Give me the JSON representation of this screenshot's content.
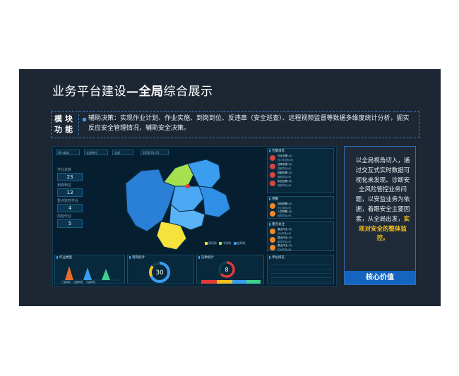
{
  "slide": {
    "title_prefix": "业务平台建设",
    "title_bold": "—全局",
    "title_suffix": "综合展示"
  },
  "module": {
    "label": "模块功能",
    "text": "辅助决策：实现作业计划、作业实施、到岗到位、反违章（安全巡查）、远程视频监督等数据多维度统计分析，掘实反应安全管理情况，辅助安全决策。"
  },
  "dashboard": {
    "selects": [
      "四川省电",
      "全部单位",
      "全部",
      "2020-01-01"
    ],
    "stats": [
      {
        "label": "作业总数",
        "value": "23"
      },
      {
        "label": "到岗到位",
        "value": "13"
      },
      {
        "label": "重点监控作业",
        "value": "4"
      },
      {
        "label": "风险作业",
        "value": "5"
      }
    ],
    "map_legend": [
      "高风险",
      "中风险",
      "低风险"
    ],
    "panels": {
      "alerts": "告警消息",
      "warn": "预警",
      "monitor": "重点关注",
      "bp1": "作业类型",
      "bp2": "到岗统计",
      "bp3": "违章统计",
      "bp4": "单位排名"
    },
    "donut1_value": "30",
    "donut2_value": "8",
    "bp1_labels": [
      "三级风险",
      "四级风险",
      "五级风险"
    ]
  },
  "core": {
    "text_plain": "以全局视角切入，通过交互式实时数据可视化来发现、诊断安全风险管控业务问题，以安监业务为依据，着眼安全主要因素，从全局出发，",
    "text_highlight": "实现对安全的整体监控。",
    "button": "核心价值"
  },
  "colors": {
    "slide_bg": "#1d2633",
    "accent_blue": "#1565c0",
    "highlight": "#f2c21a"
  }
}
